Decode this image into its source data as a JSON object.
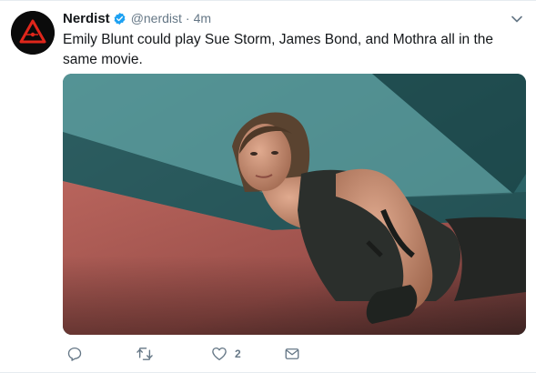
{
  "tweet": {
    "display_name": "Nerdist",
    "handle": "@nerdist",
    "separator": "·",
    "time": "4m",
    "text": "Emily Blunt could play Sue Storm, James Bond, and Mothra all in the same movie."
  },
  "actions": {
    "reply_count": "",
    "retweet_count": "",
    "like_count": "2"
  },
  "icons": {
    "avatar": "nerdist-logo-icon",
    "verified": "verified-badge-icon",
    "menu": "chevron-down-icon",
    "reply": "reply-icon",
    "retweet": "retweet-icon",
    "like": "heart-icon",
    "dm": "envelope-icon"
  },
  "colors": {
    "accent": "#1da1f2",
    "logo_red": "#e0261b",
    "secondary_text": "#657786",
    "primary_text": "#14171a"
  }
}
